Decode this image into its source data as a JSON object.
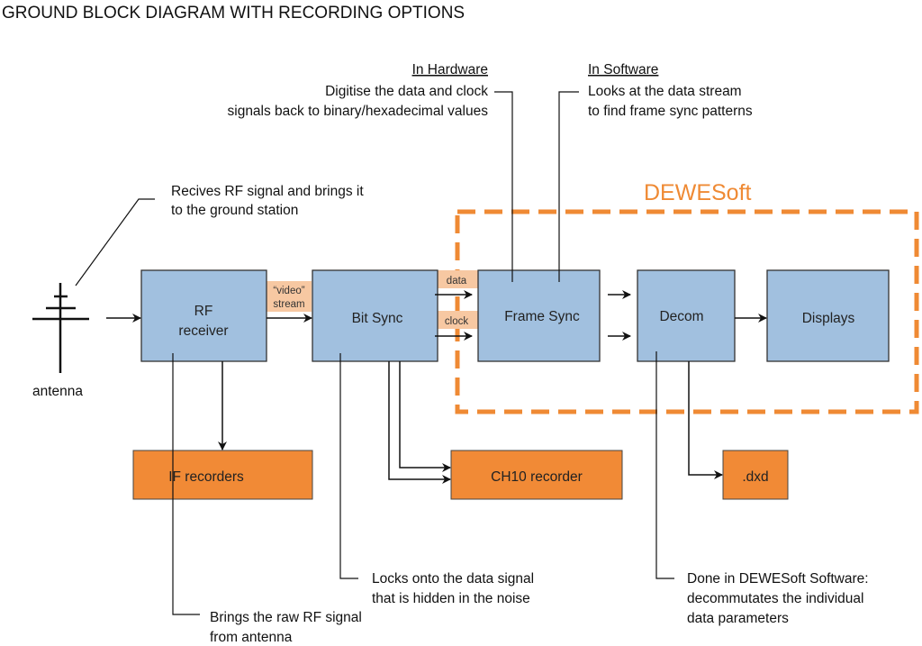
{
  "title": "GROUND BLOCK DIAGRAM WITH RECORDING OPTIONS",
  "colors": {
    "block_blue": "#a1c0df",
    "block_orange": "#f18a36",
    "tag_peach": "#f7c8a2",
    "dewesoft_orange": "#ef8a34",
    "line": "#111111"
  },
  "antenna": {
    "label": "antenna"
  },
  "blocks": {
    "rf_receiver": {
      "line1": "RF",
      "line2": "receiver"
    },
    "bit_sync": {
      "label": "Bit Sync"
    },
    "frame_sync": {
      "label": "Frame Sync"
    },
    "decom": {
      "label": "Decom"
    },
    "displays": {
      "label": "Displays"
    },
    "if_recorders": {
      "label": "IF recorders"
    },
    "ch10_recorder": {
      "label": "CH10 recorder"
    },
    "dxd": {
      "label": ".dxd"
    }
  },
  "tags": {
    "video_stream": {
      "line1": "“video”",
      "line2": "stream"
    },
    "data": "data",
    "clock": "clock"
  },
  "dewesoft_group": {
    "label": "DEWESoft"
  },
  "annotations": {
    "antenna_note": [
      "Recives RF signal and brings it",
      "to the ground station"
    ],
    "hardware_note": {
      "heading": "In Hardware",
      "lines": [
        "Digitise the data and clock",
        "signals back to binary/hexadecimal values"
      ]
    },
    "software_note": {
      "heading": "In Software",
      "lines": [
        "Looks at the data stream",
        "to find frame sync patterns"
      ]
    },
    "bitsync_note": [
      "Locks onto the data signal",
      "that is hidden in the noise"
    ],
    "rf_note": [
      "Brings the raw RF signal",
      "from antenna"
    ],
    "decom_note": [
      "Done in DEWESoft Software:",
      "decommutates the individual",
      "data parameters"
    ]
  }
}
